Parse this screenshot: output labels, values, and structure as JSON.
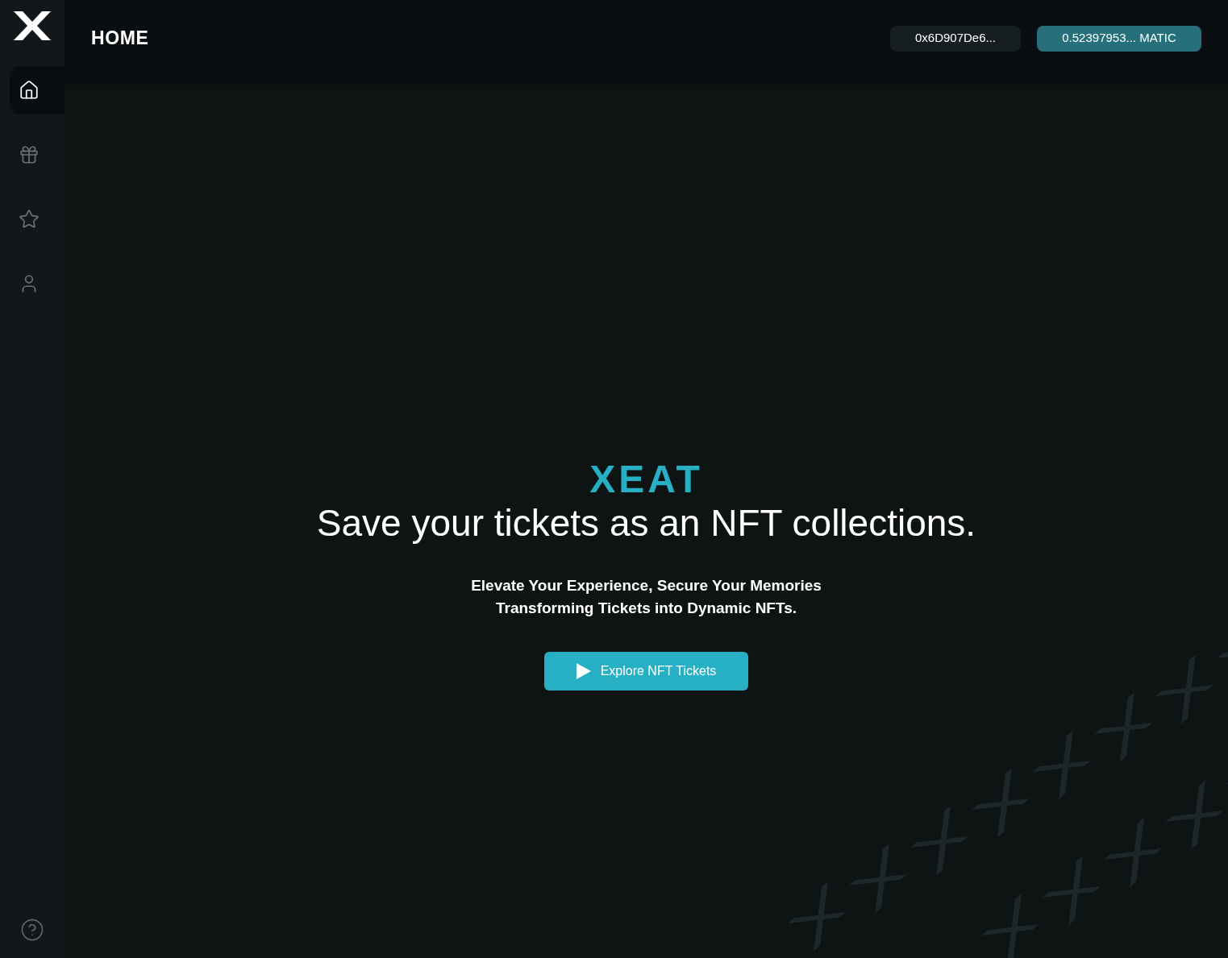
{
  "header": {
    "title": "HOME",
    "wallet_address": "0x6D907De6...",
    "balance": "0.52397953... MATIC"
  },
  "sidebar": {
    "items": [
      {
        "kind": "home",
        "selected": true
      },
      {
        "kind": "gift",
        "selected": false
      },
      {
        "kind": "star",
        "selected": false
      },
      {
        "kind": "user",
        "selected": false
      }
    ],
    "help": {
      "kind": "help"
    }
  },
  "hero": {
    "brand": "XEAT",
    "headline": "Save your tickets as an NFT collections.",
    "subtitle_lines": [
      "Elevate Your Experience, Secure Your Memories",
      "Transforming Tickets into Dynamic NFTs."
    ],
    "button": "Explore NFT Tickets"
  }
}
